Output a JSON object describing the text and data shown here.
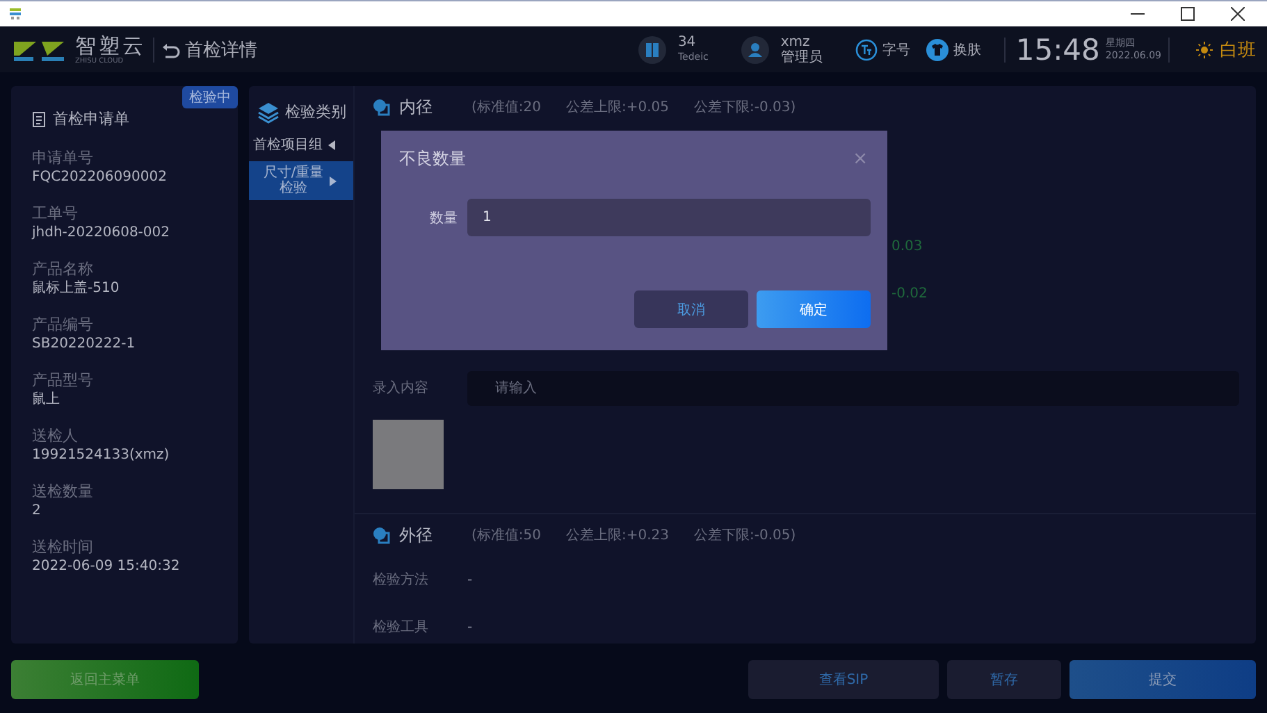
{
  "header": {
    "logo": {
      "name": "智塑云",
      "subtitle": "ZHISU CLOUD"
    },
    "page_title": "首检详情",
    "stats": [
      {
        "kind": "book",
        "line1": "34",
        "line2": "Tedeic"
      },
      {
        "kind": "user",
        "line1": "xmz",
        "line2": "管理员"
      }
    ],
    "tools": [
      {
        "kind": "font",
        "label": "字号"
      },
      {
        "kind": "skin",
        "label": "换肤"
      }
    ],
    "time": "15:48",
    "weekday": "星期四",
    "date": "2022.06.09",
    "shift": "白班"
  },
  "request": {
    "title": "首检申请单",
    "status": "检验中",
    "fields": [
      {
        "label": "申请单号",
        "value": "FQC202206090002"
      },
      {
        "label": "工单号",
        "value": "jhdh-20220608-002"
      },
      {
        "label": "产品名称",
        "value": "鼠标上盖-510"
      },
      {
        "label": "产品编号",
        "value": "SB20220222-1"
      },
      {
        "label": "产品型号",
        "value": "鼠上"
      },
      {
        "label": "送检人",
        "value": "19921524133(xmz)"
      },
      {
        "label": "送检数量",
        "value": "2"
      },
      {
        "label": "送检时间",
        "value": "2022-06-09 15:40:32"
      }
    ]
  },
  "categories": {
    "title": "检验类别",
    "groups": [
      {
        "label": "首检项目组",
        "children": [
          {
            "label": "尺寸/重量检验",
            "selected": true
          }
        ]
      }
    ]
  },
  "items": [
    {
      "name": "内径",
      "specs": [
        "(标准值:20",
        "公差上限:+0.05",
        "公差下限:-0.03)"
      ],
      "fragments": [
        "0.03",
        "-0.02"
      ],
      "input": {
        "label": "录入内容",
        "placeholder": "请输入"
      },
      "has_photo": true
    },
    {
      "name": "外径",
      "specs": [
        "(标准值:50",
        "公差上限:+0.23",
        "公差下限:-0.05)"
      ],
      "rows": [
        {
          "label": "检验方法",
          "value": "-"
        },
        {
          "label": "检验工具",
          "value": "-"
        }
      ]
    }
  ],
  "footer": {
    "back": "返回主菜单",
    "buttons": [
      {
        "kind": "plain",
        "label": "查看SIP"
      },
      {
        "kind": "plain",
        "label": "暂存"
      },
      {
        "kind": "primary",
        "label": "提交"
      }
    ]
  },
  "dialog": {
    "title": "不良数量",
    "close": "×",
    "field": {
      "label": "数量",
      "value": "1"
    },
    "buttons": [
      {
        "kind": "cancel",
        "label": "取消"
      },
      {
        "kind": "confirm",
        "label": "确定"
      }
    ]
  }
}
